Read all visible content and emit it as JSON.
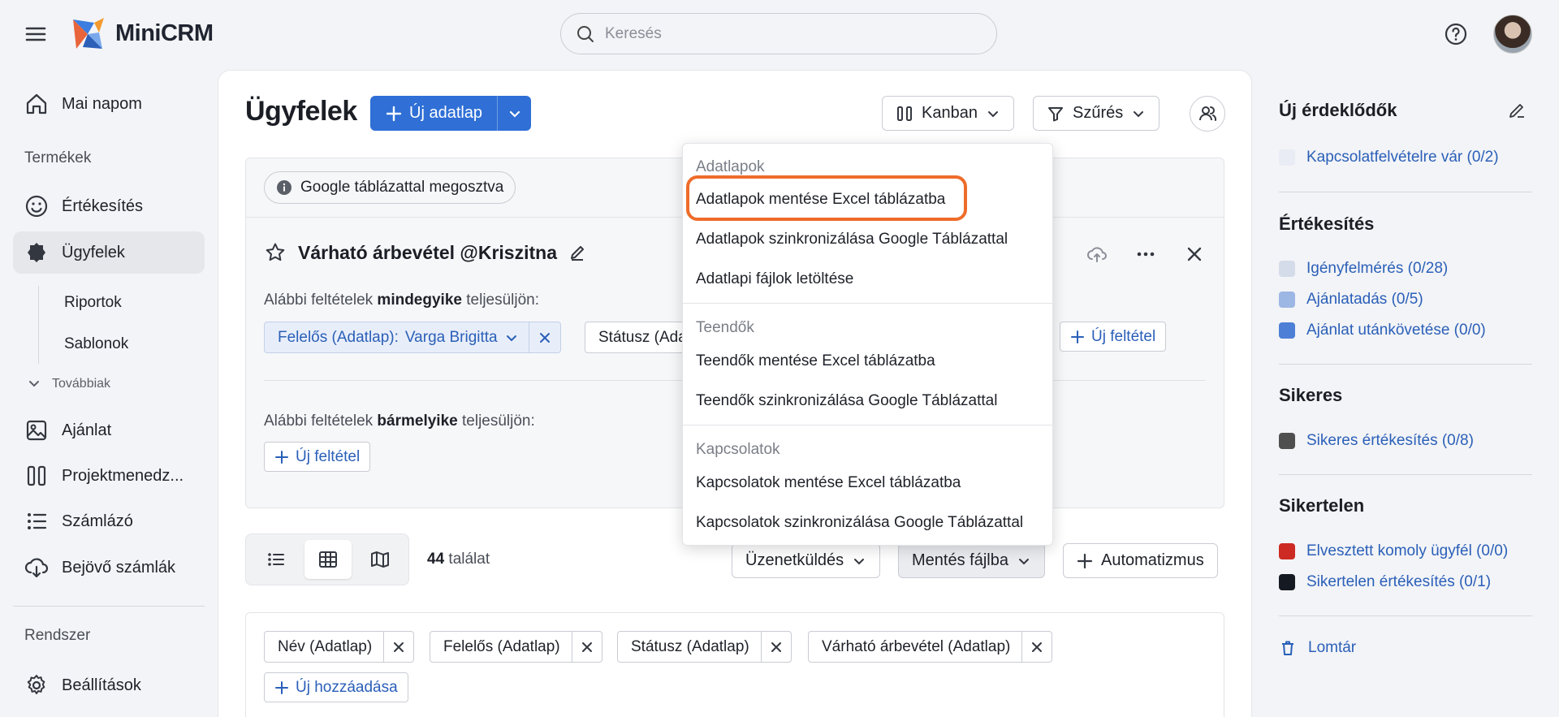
{
  "topbar": {
    "brand": "MiniCRM",
    "search_placeholder": "Keresés"
  },
  "sidebar": {
    "today": "Mai napom",
    "products_section": "Termékek",
    "sales": "Értékesítés",
    "clients": "Ügyfelek",
    "reports": "Riportok",
    "templates": "Sablonok",
    "more": "Továbbiak",
    "offer": "Ajánlat",
    "project": "Projektmenedz...",
    "invoicing": "Számlázó",
    "incoming": "Bejövő számlák",
    "system_section": "Rendszer",
    "settings": "Beállítások"
  },
  "header": {
    "title": "Ügyfelek",
    "new_button": "Új adatlap",
    "kanban": "Kanban",
    "filter": "Szűrés"
  },
  "filter": {
    "shared_chip": "Google táblázattal megosztva",
    "name": "Várható árbevétel @Kriszitna",
    "all_prefix": "Alábbi feltételek ",
    "all_bold": "mindegyike",
    "all_suffix": " teljesüljön:",
    "cond1_key": "Felelős (Adatlap):",
    "cond1_value": "Varga Brigitta",
    "cond2": "Státusz (Adatlap)",
    "new_condition": "Új feltétel",
    "any_prefix": "Alábbi feltételek ",
    "any_bold": "bármelyike",
    "any_suffix": " teljesüljön:"
  },
  "toolbar": {
    "count": "44",
    "count_label": " találat",
    "messaging": "Üzenetküldés",
    "save_to_file": "Mentés fájlba",
    "automation": "Automatizmus"
  },
  "columns": {
    "items": [
      "Név (Adatlap)",
      "Felelős (Adatlap)",
      "Státusz (Adatlap)",
      "Várható árbevétel (Adatlap)"
    ],
    "add": "Új hozzáadása"
  },
  "dropdown": {
    "g1": "Adatlapok",
    "g1_items": [
      "Adatlapok mentése Excel táblázatba",
      "Adatlapok szinkronizálása Google Táblázattal",
      "Adatlapi fájlok letöltése"
    ],
    "g2": "Teendők",
    "g2_items": [
      "Teendők mentése Excel táblázatba",
      "Teendők szinkronizálása Google Táblázattal"
    ],
    "g3": "Kapcsolatok",
    "g3_items": [
      "Kapcsolatok mentése Excel táblázatba",
      "Kapcsolatok szinkronizálása Google Táblázattal"
    ]
  },
  "right_panel": {
    "s1_title": "Új érdeklődők",
    "s1_items": [
      "Kapcsolatfelvételre vár (0/2)"
    ],
    "s2_title": "Értékesítés",
    "s2_items": [
      "Igényfelmérés (0/28)",
      "Ajánlatadás (0/5)",
      "Ajánlat utánkövetése (0/0)"
    ],
    "s3_title": "Sikeres",
    "s3_items": [
      "Sikeres értékesítés (0/8)"
    ],
    "s4_title": "Sikertelen",
    "s4_items": [
      "Elvesztett komoly ügyfél (0/0)",
      "Sikertelen értékesítés (0/1)"
    ],
    "trash": "Lomtár"
  },
  "colors": {
    "primary": "#2f6fd6",
    "highlight": "#ee6c2a",
    "status_waiting": "#e9ecf4",
    "status_survey": "#d4dcea",
    "status_offer": "#9db7e4",
    "status_followup": "#4d7fd6",
    "status_success": "#4f4f4f",
    "status_lost": "#cc2a22",
    "status_fail": "#151a22"
  }
}
